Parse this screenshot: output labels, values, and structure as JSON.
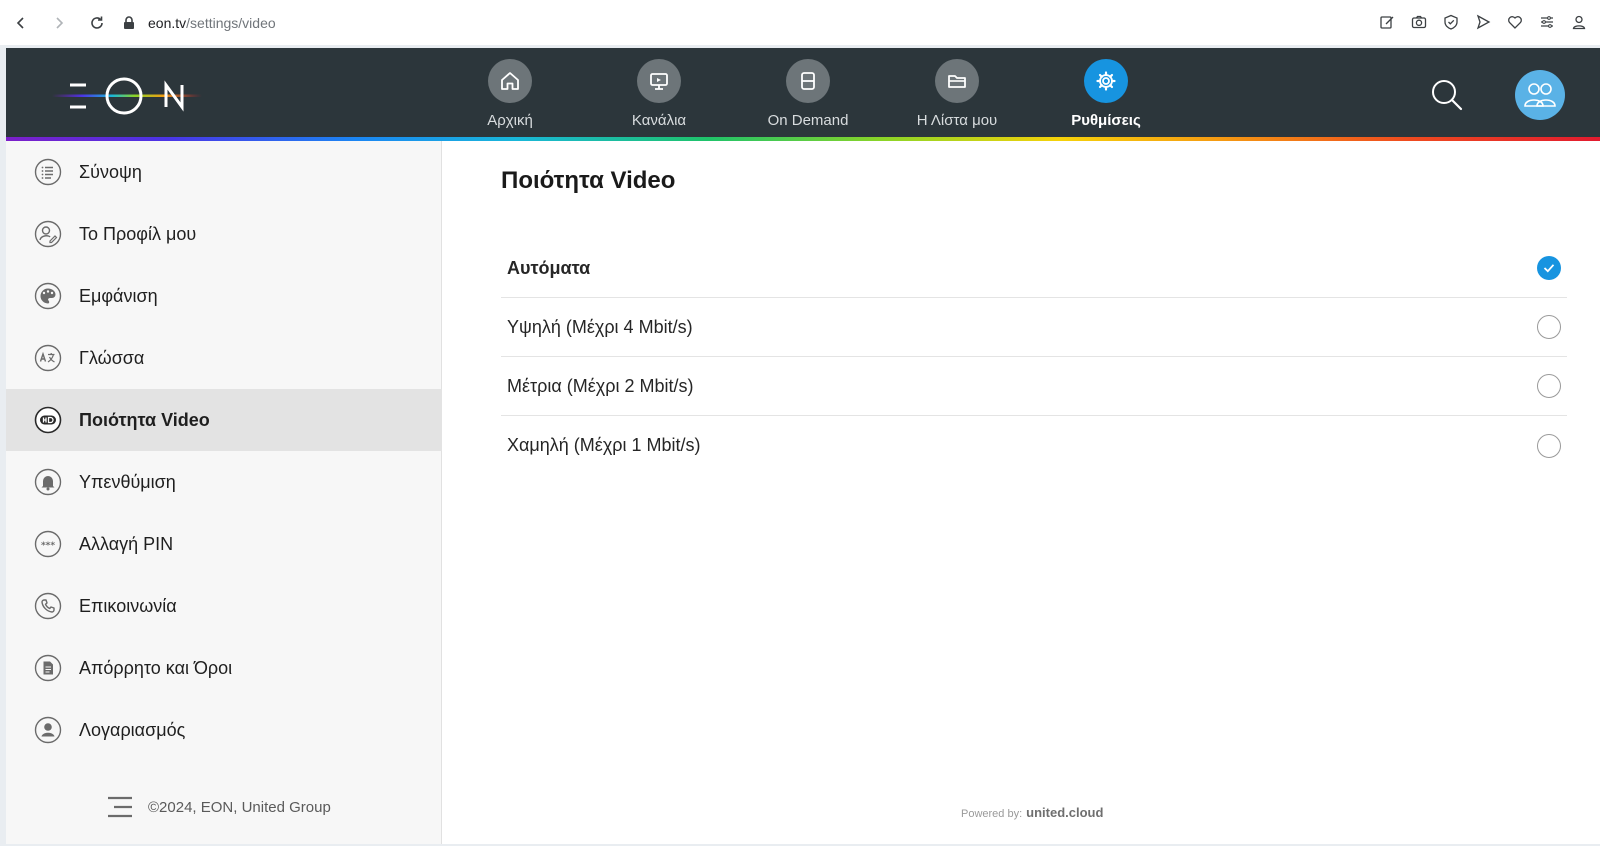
{
  "browser": {
    "url_host": "eon.tv",
    "url_path": "/settings/video"
  },
  "topnav": {
    "items": [
      {
        "label": "Αρχική",
        "icon": "home-icon"
      },
      {
        "label": "Κανάλια",
        "icon": "channels-icon"
      },
      {
        "label": "On Demand",
        "icon": "film-icon"
      },
      {
        "label": "Η Λίστα μου",
        "icon": "folder-icon"
      },
      {
        "label": "Ρυθμίσεις",
        "icon": "gear-icon",
        "active": true
      }
    ]
  },
  "sidebar": {
    "items": [
      {
        "label": "Σύνοψη",
        "icon": "list-icon"
      },
      {
        "label": "Το Προφίλ μου",
        "icon": "profile-edit-icon"
      },
      {
        "label": "Εμφάνιση",
        "icon": "palette-icon"
      },
      {
        "label": "Γλώσσα",
        "icon": "language-icon"
      },
      {
        "label": "Ποιότητα Video",
        "icon": "hd-icon",
        "active": true
      },
      {
        "label": "Υπενθύμιση",
        "icon": "bell-icon"
      },
      {
        "label": "Αλλαγή PIN",
        "icon": "pin-icon"
      },
      {
        "label": "Επικοινωνία",
        "icon": "phone-icon"
      },
      {
        "label": "Απόρρητο και Όροι",
        "icon": "document-icon"
      },
      {
        "label": "Λογαριασμός",
        "icon": "account-icon"
      }
    ],
    "footer": "©2024, EON, United Group"
  },
  "content": {
    "title": "Ποιότητα Video",
    "options": [
      {
        "label": "Αυτόματα",
        "selected": true
      },
      {
        "label": "Υψηλή (Μέχρι 4 Mbit/s)",
        "selected": false
      },
      {
        "label": "Μέτρια (Μέχρι 2 Mbit/s)",
        "selected": false
      },
      {
        "label": "Χαμηλή (Μέχρι 1 Mbit/s)",
        "selected": false
      }
    ],
    "powered_prefix": "Powered by:",
    "powered_brand": "united.cloud"
  },
  "colors": {
    "topbar": "#2c363b",
    "accent": "#1794e0",
    "sidebar_active": "#e3e3e3"
  }
}
